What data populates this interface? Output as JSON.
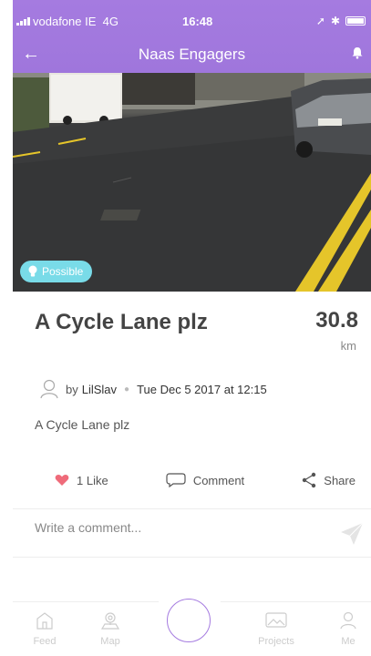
{
  "status_bar": {
    "carrier": "vodafone IE",
    "network": "4G",
    "time": "16:48"
  },
  "header": {
    "title": "Naas Engagers"
  },
  "post": {
    "badge": "Possible",
    "title": "A Cycle Lane plz",
    "distance": "30.8",
    "distance_unit": "km",
    "by_prefix": "by",
    "author": "LilSlav",
    "date": "Tue Dec 5 2017 at 12:15",
    "body": "A Cycle Lane plz"
  },
  "actions": {
    "like": "1 Like",
    "comment": "Comment",
    "share": "Share"
  },
  "comment": {
    "placeholder": "Write a comment..."
  },
  "tabbar": {
    "feed": "Feed",
    "map": "Map",
    "projects": "Projects",
    "me": "Me"
  },
  "colors": {
    "accent": "#a57be0",
    "badge": "#79dbe8",
    "like": "#ef6b7a"
  }
}
